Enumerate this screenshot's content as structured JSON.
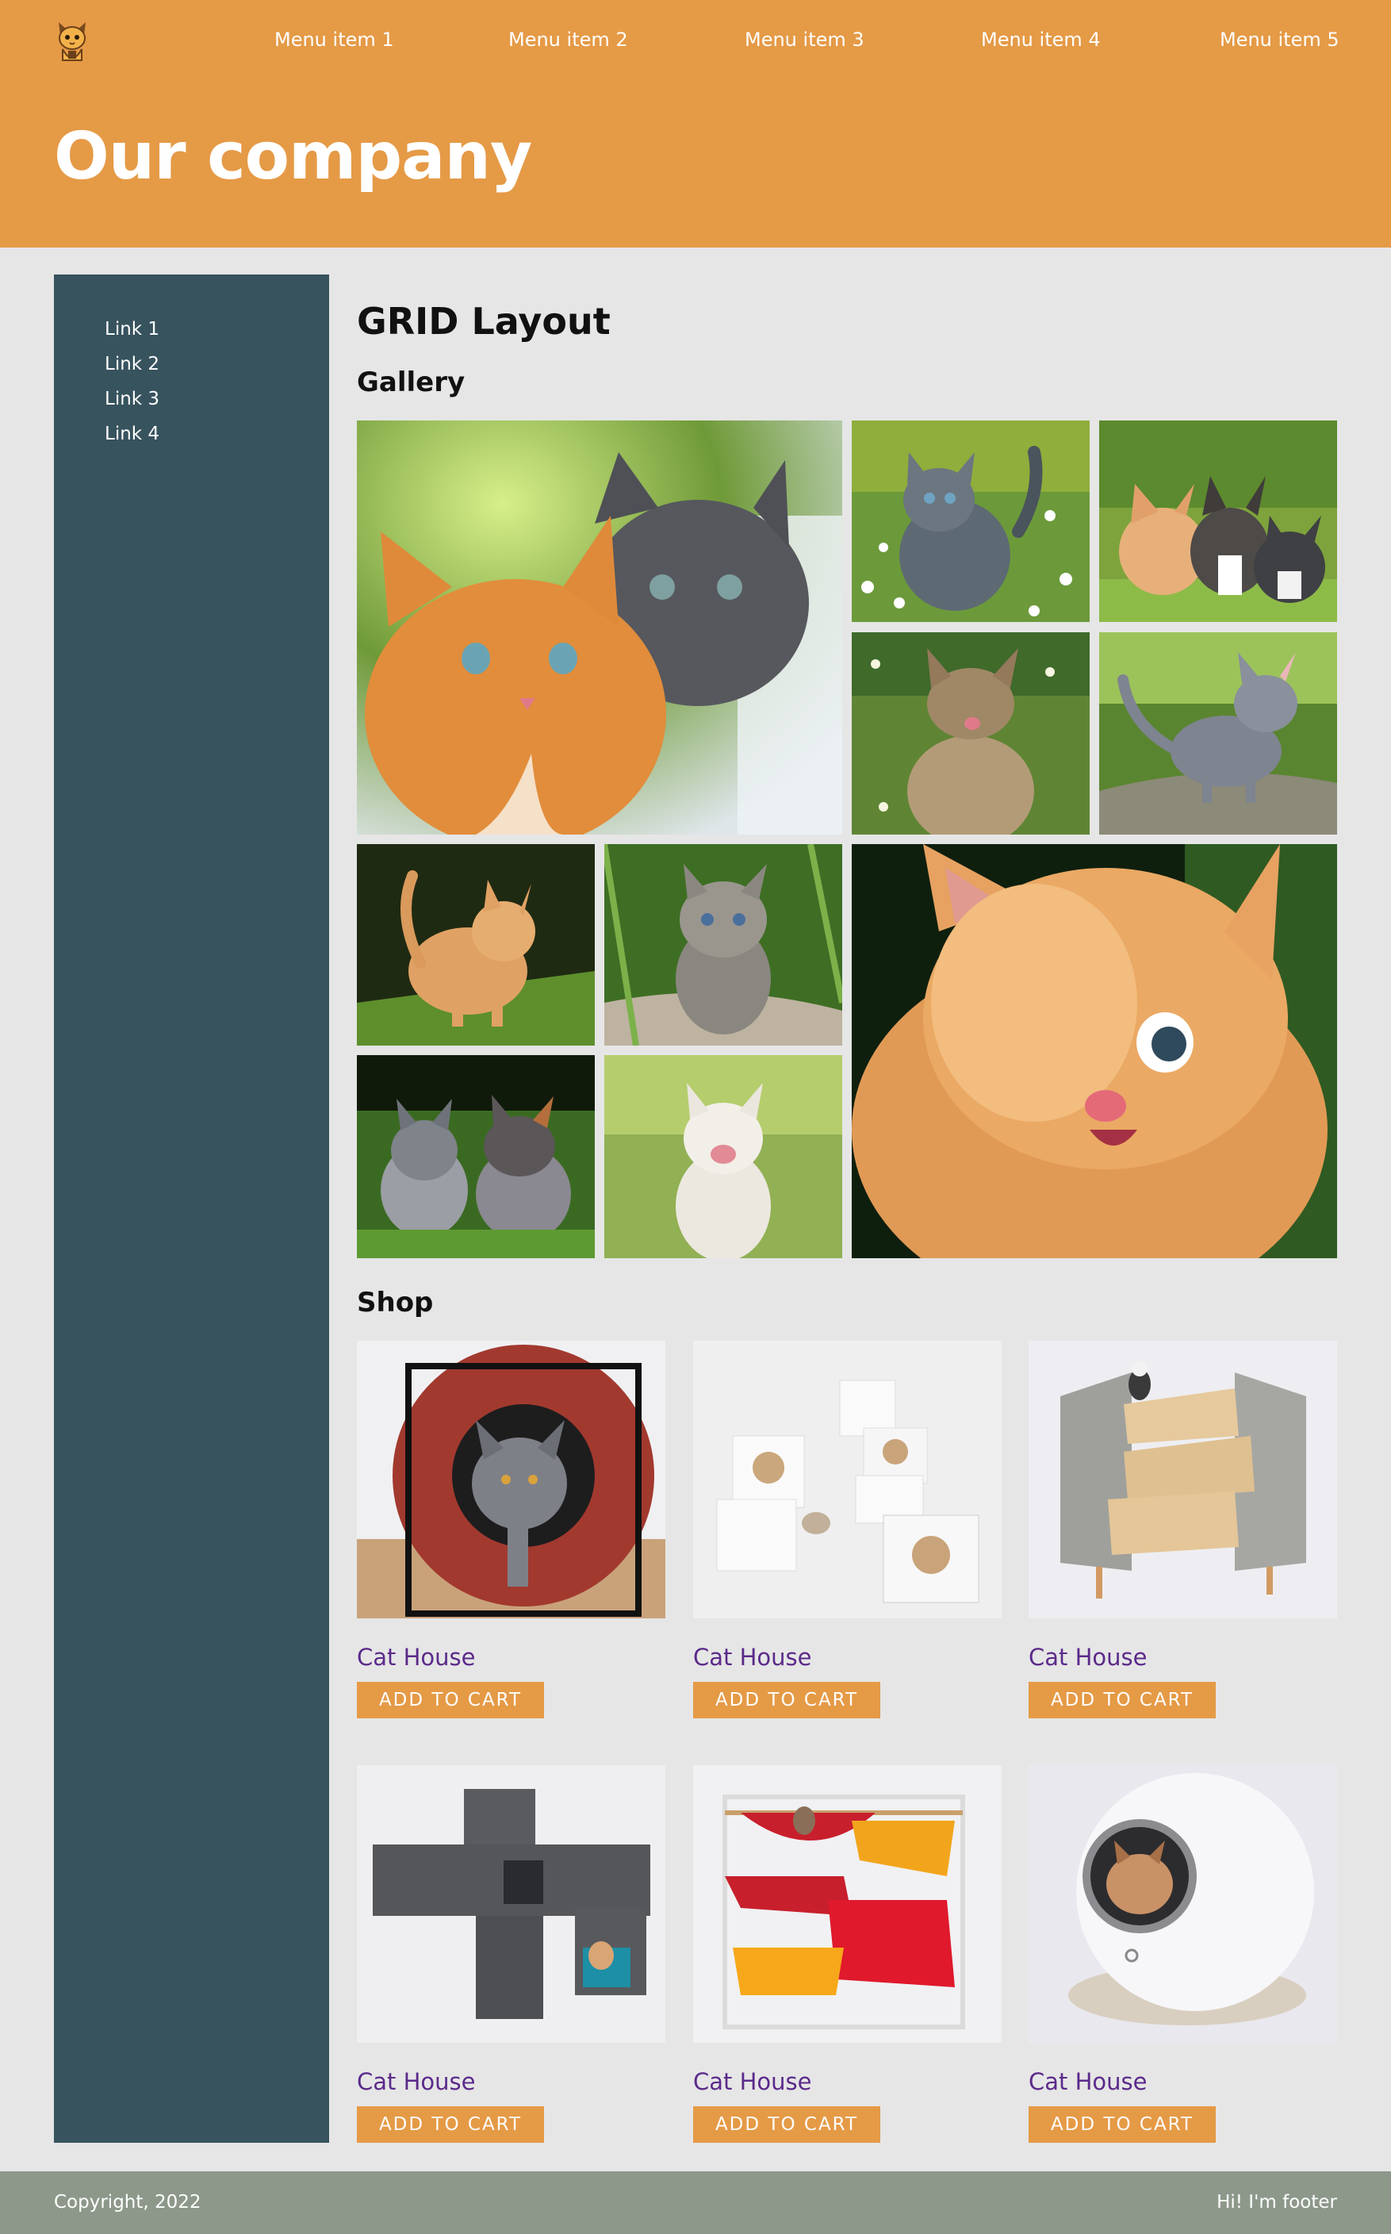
{
  "header": {
    "title": "Our company",
    "nav": [
      "Menu item 1",
      "Menu item 2",
      "Menu item 3",
      "Menu item 4",
      "Menu item 5"
    ],
    "logo_icon": "cat-logo-icon"
  },
  "sidebar": {
    "links": [
      "Link 1",
      "Link 2",
      "Link 3",
      "Link 4"
    ]
  },
  "main": {
    "title": "GRID Layout",
    "gallery_title": "Gallery",
    "shop_title": "Shop"
  },
  "shop": {
    "products": [
      {
        "name": "Cat House",
        "button": "ADD TO CART"
      },
      {
        "name": "Cat House",
        "button": "ADD TO CART"
      },
      {
        "name": "Cat House",
        "button": "ADD TO CART"
      },
      {
        "name": "Cat House",
        "button": "ADD TO CART"
      },
      {
        "name": "Cat House",
        "button": "ADD TO CART"
      },
      {
        "name": "Cat House",
        "button": "ADD TO CART"
      }
    ]
  },
  "footer": {
    "left": "Copyright, 2022",
    "right": "Hi! I'm footer"
  },
  "colors": {
    "header": "#e59a46",
    "sidebar": "#37535e",
    "footer": "#8d988a",
    "background": "#e6e6e6",
    "product_link": "#5b2a8a"
  }
}
